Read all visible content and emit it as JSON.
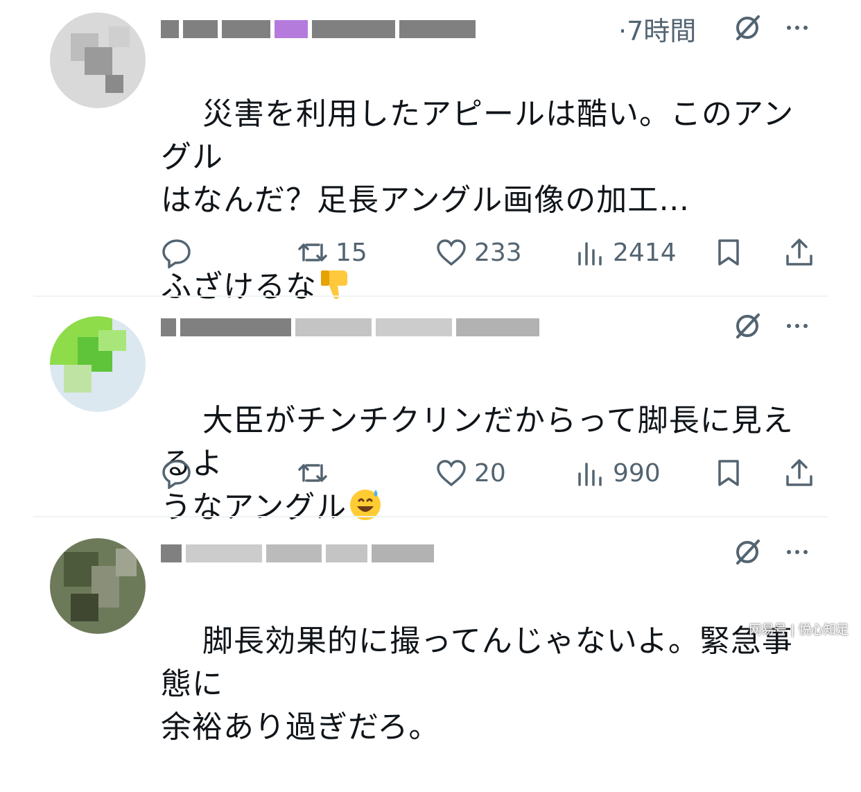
{
  "posts": [
    {
      "time": "·7時間",
      "text": "災害を利用したアピールは酷い。このアングル\nはなんだ？足長アングル画像の加工…\n\nふざけるな",
      "emoji": "thumbs-down",
      "actions": {
        "reply": "",
        "repost": "15",
        "like": "233",
        "views": "2414"
      }
    },
    {
      "time": "",
      "text": "大臣がチンチクリンだからって脚長に見えるよ\nうなアングル",
      "emoji": "grinning-sweat",
      "actions": {
        "reply": "",
        "repost": "",
        "like": "20",
        "views": "990"
      }
    },
    {
      "time": "",
      "text": "脚長効果的に撮ってんじゃないよ。緊急事態に\n余裕あり過ぎだろ。",
      "emoji": "",
      "actions": {
        "reply": "",
        "repost": "",
        "like": "",
        "views": ""
      }
    }
  ],
  "watermark": "网易号 | 悦心知足",
  "colors": {
    "text": "#0f1419",
    "muted": "#536471",
    "divider": "#eff3f4"
  },
  "icons": [
    "reply-icon",
    "repost-icon",
    "like-icon",
    "views-icon",
    "bookmark-icon",
    "share-icon",
    "grok-icon",
    "more-icon"
  ]
}
